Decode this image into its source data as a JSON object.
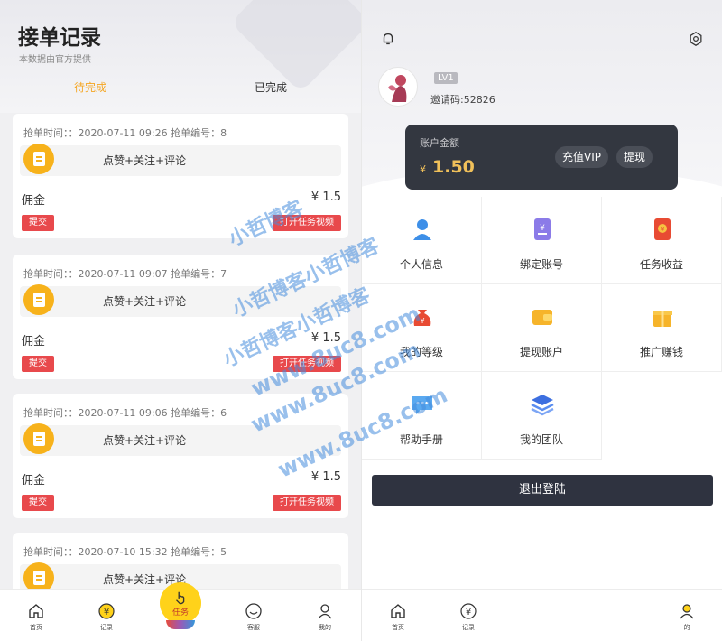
{
  "left": {
    "title": "接单记录",
    "subtitle": "本数据由官方提供",
    "tabs": {
      "pending": "待完成",
      "done": "已完成"
    },
    "records": [
      {
        "time": "抢单时间：：2020-07-11 09:26 抢单编号：8",
        "task": "点赞+关注+评论",
        "fee_label": "佣金",
        "fee_value": "¥ 1.5",
        "submit": "提交",
        "video": "打开任务视频"
      },
      {
        "time": "抢单时间：：2020-07-11 09:07 抢单编号：7",
        "task": "点赞+关注+评论",
        "fee_label": "佣金",
        "fee_value": "¥ 1.5",
        "submit": "提交",
        "video": "打开任务视频"
      },
      {
        "time": "抢单时间：：2020-07-11 09:06 抢单编号：6",
        "task": "点赞+关注+评论",
        "fee_label": "佣金",
        "fee_value": "¥ 1.5",
        "submit": "提交",
        "video": "打开任务视频"
      },
      {
        "time": "抢单时间：：2020-07-10 15:32 抢单编号：5",
        "task": "点赞+关注+评论"
      }
    ],
    "nav": {
      "home": "首页",
      "records": "记录",
      "task": "任务",
      "service": "客服",
      "mine": "我的"
    }
  },
  "right": {
    "level": "LV1",
    "invite": "邀请码:52826",
    "balance_label": "账户金额",
    "currency": "¥",
    "balance": "1.50",
    "vip": "充值VIP",
    "withdraw": "提现",
    "grid": [
      "个人信息",
      "绑定账号",
      "任务收益",
      "我的等级",
      "提现账户",
      "推广赚钱",
      "帮助手册",
      "我的团队"
    ],
    "logout": "退出登陆",
    "nav": {
      "home": "首页",
      "records": "记录",
      "mine": "的"
    }
  },
  "watermark": {
    "line1": "小哲博客",
    "line2": "小哲博客小哲博客",
    "line3": "小哲博客小哲博客",
    "line4": "www.8uc8.com",
    "line5": "www.8uc8.com",
    "line6": "www.8uc8.com"
  },
  "colors": {
    "accent": "#f5a623",
    "danger": "#e8494c",
    "dark": "#2f3340"
  }
}
